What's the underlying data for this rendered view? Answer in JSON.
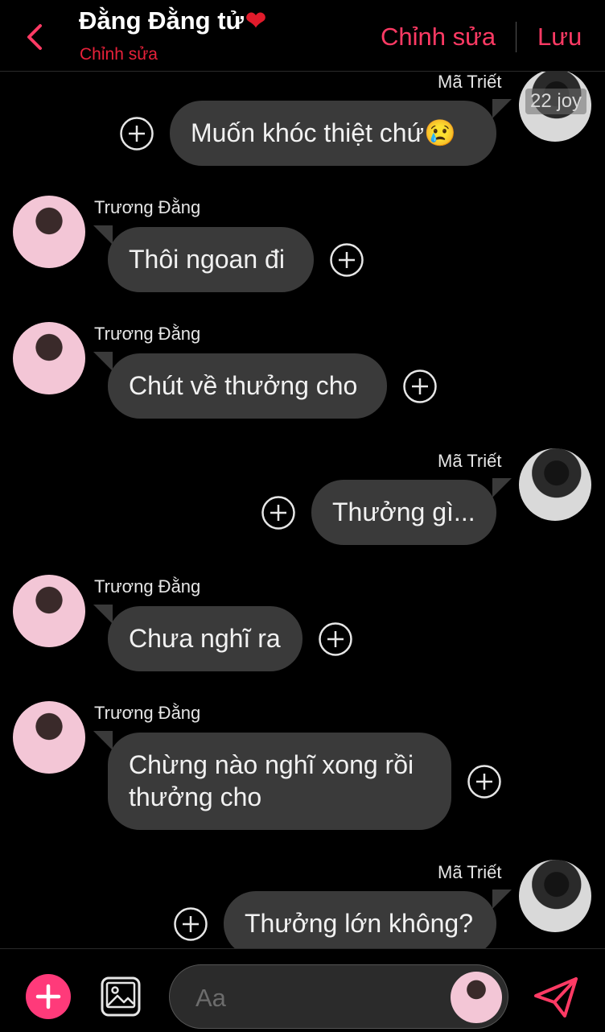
{
  "header": {
    "title": "Đằng Đằng tử",
    "title_emoji": "❤",
    "subtitle": "Chỉnh sửa",
    "edit_label": "Chỉnh sửa",
    "save_label": "Lưu"
  },
  "watermark": "22 joy",
  "messages": [
    {
      "side": "right",
      "sender": "Mã Triết",
      "text": "Muốn khóc thiệt chứ😢"
    },
    {
      "side": "left",
      "sender": "Trương Đằng",
      "text": "Thôi ngoan đi"
    },
    {
      "side": "left",
      "sender": "Trương Đằng",
      "text": "Chút về thưởng cho"
    },
    {
      "side": "right",
      "sender": "Mã Triết",
      "text": "Thưởng gì..."
    },
    {
      "side": "left",
      "sender": "Trương Đằng",
      "text": "Chưa nghĩ ra"
    },
    {
      "side": "left",
      "sender": "Trương Đằng",
      "text_line1": "Chừng nào nghĩ xong rồi",
      "text_line2": "thưởng cho"
    },
    {
      "side": "right",
      "sender": "Mã Triết",
      "text": "Thưởng lớn không?"
    }
  ],
  "composer": {
    "placeholder": "Aa"
  },
  "colors": {
    "accent": "#ff3a64",
    "subtitle": "#e8213a",
    "bubble": "#3a3a3a",
    "add_button": "#ff3a7a"
  },
  "icons": [
    "back-chevron-icon",
    "add-reaction-icon",
    "plus-icon",
    "image-icon",
    "send-icon"
  ]
}
